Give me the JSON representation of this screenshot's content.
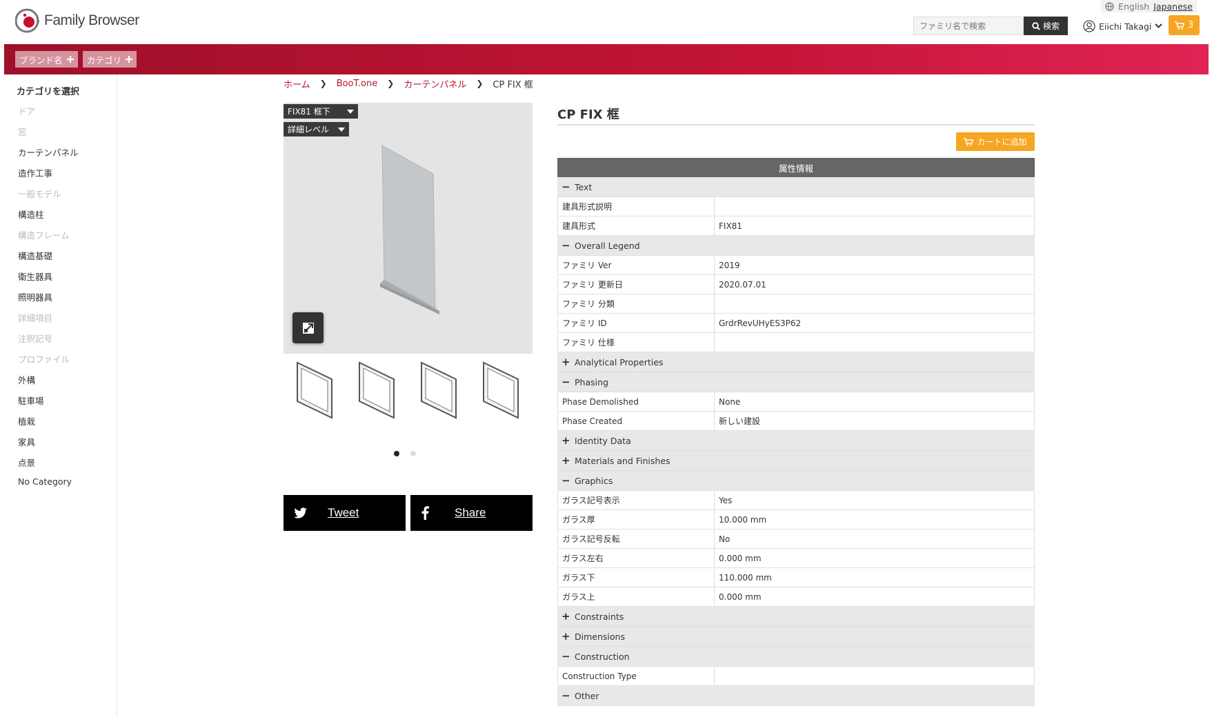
{
  "header": {
    "logo_text": "Family Browser",
    "lang_english": "English",
    "lang_japanese": "Japanese",
    "search_placeholder": "ファミリ名で検索",
    "search_button": "検索",
    "user_name": "Eiichi Takagi",
    "cart_count": "3",
    "accent_color": "#c21434",
    "cart_color": "#f6a623"
  },
  "filters": {
    "brand": "ブランド名",
    "category": "カテゴリ"
  },
  "sidebar": {
    "title": "カテゴリを選択",
    "items": [
      {
        "label": "ドア",
        "enabled": false
      },
      {
        "label": "窓",
        "enabled": false
      },
      {
        "label": "カーテンパネル",
        "enabled": true
      },
      {
        "label": "造作工事",
        "enabled": true
      },
      {
        "label": "一般モデル",
        "enabled": false
      },
      {
        "label": "構造柱",
        "enabled": true
      },
      {
        "label": "構造フレーム",
        "enabled": false
      },
      {
        "label": "構造基礎",
        "enabled": true
      },
      {
        "label": "衛生器具",
        "enabled": true
      },
      {
        "label": "照明器具",
        "enabled": true
      },
      {
        "label": "詳細項目",
        "enabled": false
      },
      {
        "label": "注釈記号",
        "enabled": false
      },
      {
        "label": "プロファイル",
        "enabled": false
      },
      {
        "label": "外構",
        "enabled": true
      },
      {
        "label": "駐車場",
        "enabled": true
      },
      {
        "label": "植栽",
        "enabled": true
      },
      {
        "label": "家具",
        "enabled": true
      },
      {
        "label": "点景",
        "enabled": true
      },
      {
        "label": "No Category",
        "enabled": true
      }
    ]
  },
  "breadcrumb": {
    "home": "ホーム",
    "brand": "BooT.one",
    "category": "カーテンパネル",
    "current": "CP FIX 框"
  },
  "viewer": {
    "type_select": "FIX81 框下",
    "detail_select": "詳細レベル"
  },
  "share": {
    "tweet": "Tweet",
    "facebook": "Share"
  },
  "product": {
    "title": "CP FIX 框",
    "add_to_cart": "カートに追加",
    "attributes_header": "属性情報"
  },
  "attributes": [
    {
      "group": "Text",
      "expanded": true,
      "rows": [
        {
          "k": "建具形式説明",
          "v": ""
        },
        {
          "k": "建具形式",
          "v": "FIX81"
        }
      ]
    },
    {
      "group": "Overall Legend",
      "expanded": true,
      "rows": [
        {
          "k": "ファミリ Ver",
          "v": "2019"
        },
        {
          "k": "ファミリ 更新日",
          "v": "2020.07.01"
        },
        {
          "k": "ファミリ 分類",
          "v": ""
        },
        {
          "k": "ファミリ ID",
          "v": "GrdrRevUHyES3P62"
        },
        {
          "k": "ファミリ 仕様",
          "v": ""
        }
      ]
    },
    {
      "group": "Analytical Properties",
      "expanded": false,
      "rows": []
    },
    {
      "group": "Phasing",
      "expanded": true,
      "rows": [
        {
          "k": "Phase Demolished",
          "v": "None"
        },
        {
          "k": "Phase Created",
          "v": "新しい建設"
        }
      ]
    },
    {
      "group": "Identity Data",
      "expanded": false,
      "rows": []
    },
    {
      "group": "Materials and Finishes",
      "expanded": false,
      "rows": []
    },
    {
      "group": "Graphics",
      "expanded": true,
      "rows": [
        {
          "k": "ガラス記号表示",
          "v": "Yes"
        },
        {
          "k": "ガラス厚",
          "v": "10.000 mm"
        },
        {
          "k": "ガラス記号反転",
          "v": "No"
        },
        {
          "k": "ガラス左右",
          "v": "0.000 mm"
        },
        {
          "k": "ガラス下",
          "v": "110.000 mm"
        },
        {
          "k": "ガラス上",
          "v": "0.000 mm"
        }
      ]
    },
    {
      "group": "Constraints",
      "expanded": false,
      "rows": []
    },
    {
      "group": "Dimensions",
      "expanded": false,
      "rows": []
    },
    {
      "group": "Construction",
      "expanded": true,
      "rows": [
        {
          "k": "Construction Type",
          "v": ""
        }
      ]
    },
    {
      "group": "Other",
      "expanded": true,
      "rows": []
    }
  ]
}
